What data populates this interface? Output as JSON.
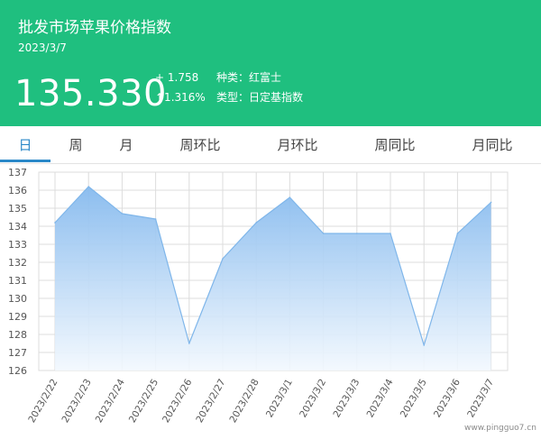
{
  "header": {
    "title": "批发市场苹果价格指数",
    "date": "2023/3/7",
    "price": "135.330",
    "change": "+ 1.758",
    "change_pct": "↑1.316%",
    "variety": "种类：红富士",
    "type": "类型：日定基指数"
  },
  "tabs": [
    "日",
    "周",
    "月",
    "周环比",
    "月环比",
    "周同比",
    "月同比"
  ],
  "active_tab": 0,
  "watermark": "www.pingguo7.cn",
  "colors": {
    "header_bg": "#1fbf7f",
    "active_tab": "#2a88c8",
    "line": "#7fb6ea",
    "fill_top": "#86baee",
    "fill_bottom": "#f2f8fe",
    "grid": "#dcdcdc"
  },
  "chart_data": {
    "type": "area",
    "categories": [
      "2023/2/22",
      "2023/2/23",
      "2023/2/24",
      "2023/2/25",
      "2023/2/26",
      "2023/2/27",
      "2023/2/28",
      "2023/3/1",
      "2023/3/2",
      "2023/3/3",
      "2023/3/4",
      "2023/3/5",
      "2023/3/6",
      "2023/3/7"
    ],
    "values": [
      134.2,
      136.2,
      134.7,
      134.4,
      127.5,
      132.2,
      134.2,
      135.6,
      133.6,
      133.6,
      133.6,
      127.4,
      133.6,
      135.33
    ],
    "ylim": [
      126,
      137
    ],
    "yticks": [
      126,
      127,
      128,
      129,
      130,
      131,
      132,
      133,
      134,
      135,
      136,
      137
    ],
    "grid": true
  }
}
